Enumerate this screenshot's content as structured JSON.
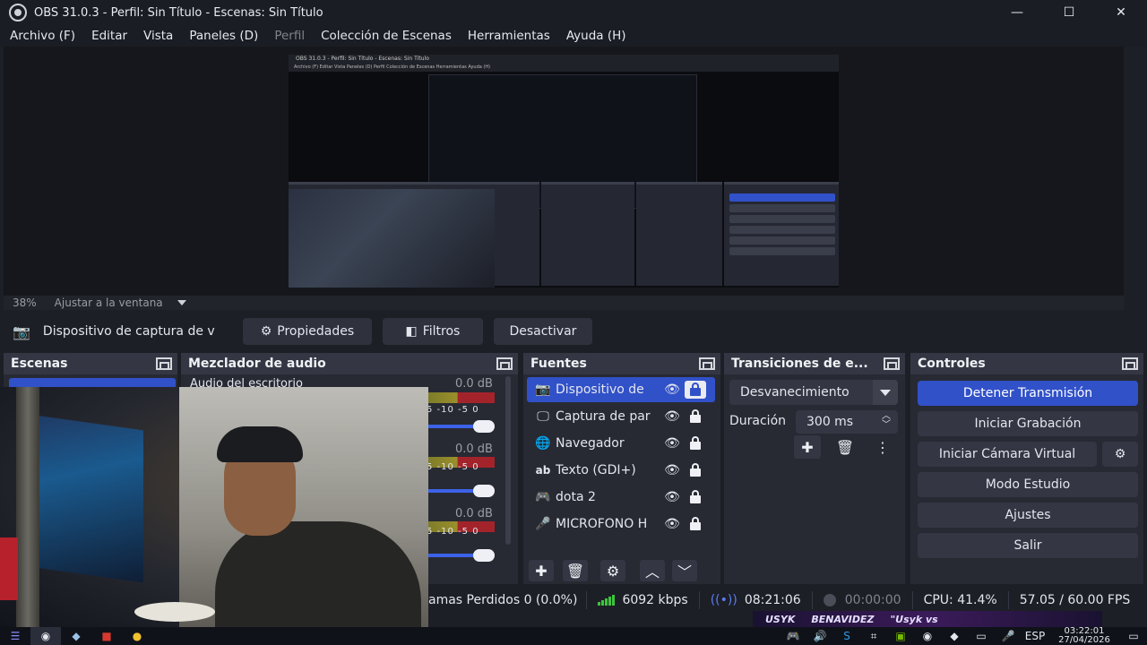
{
  "window": {
    "title": "OBS 31.0.3 - Perfil: Sin Título - Escenas: Sin Título",
    "minimize": "—",
    "maximize": "☐",
    "close": "✕"
  },
  "menu": [
    {
      "label": "Archivo (F)",
      "enabled": true
    },
    {
      "label": "Editar",
      "enabled": true
    },
    {
      "label": "Vista",
      "enabled": true
    },
    {
      "label": "Paneles (D)",
      "enabled": true
    },
    {
      "label": "Perfil",
      "enabled": false
    },
    {
      "label": "Colección de Escenas",
      "enabled": true
    },
    {
      "label": "Herramientas",
      "enabled": true
    },
    {
      "label": "Ayuda (H)",
      "enabled": true
    }
  ],
  "zoom": {
    "value": "38%",
    "mode": "Ajustar a la ventana"
  },
  "source_toolbar": {
    "source_name": "Dispositivo de captura de v",
    "properties": "Propiedades",
    "filters": "Filtros",
    "deactivate": "Desactivar"
  },
  "scenes": {
    "title": "Escenas"
  },
  "mixer": {
    "title": "Mezclador de audio",
    "channels": [
      {
        "label": "Audio del escritorio",
        "db": "0.0 dB",
        "scale": "5 -10 -5 0"
      },
      {
        "label": "",
        "db": "0.0 dB",
        "scale": "5 -10 -5 0"
      },
      {
        "label": "",
        "db": "0.0 dB",
        "scale": "5 -10 -5 0"
      }
    ]
  },
  "sources": {
    "title": "Fuentes",
    "items": [
      {
        "name": "Dispositivo de",
        "icon": "camera-icon",
        "glyph": "📷",
        "selected": true
      },
      {
        "name": "Captura de par",
        "icon": "monitor-icon",
        "glyph": "🖵",
        "selected": false
      },
      {
        "name": "Navegador",
        "icon": "globe-icon",
        "glyph": "🌐",
        "selected": false
      },
      {
        "name": "Texto (GDI+)",
        "icon": "text-icon",
        "glyph": "ab",
        "selected": false
      },
      {
        "name": "dota 2",
        "icon": "gamepad-icon",
        "glyph": "🎮",
        "selected": false
      },
      {
        "name": "MICROFONO H",
        "icon": "microphone-icon",
        "glyph": "🎤",
        "selected": false
      }
    ]
  },
  "transitions": {
    "title": "Transiciones de e...",
    "selected": "Desvanecimiento",
    "duration_label": "Duración",
    "duration": "300 ms"
  },
  "controls": {
    "title": "Controles",
    "stop_stream": "Detener Transmisión",
    "start_recording": "Iniciar Grabación",
    "virtual_camera": "Iniciar Cámara Virtual",
    "studio_mode": "Modo Estudio",
    "settings": "Ajustes",
    "exit": "Salir"
  },
  "status": {
    "dropped_frames": "amas Perdidos 0 (0.0%)",
    "bitrate": "6092 kbps",
    "stream_time": "08:21:06",
    "record_time": "00:00:00",
    "cpu": "CPU: 41.4%",
    "fps": "57.05 / 60.00 FPS"
  },
  "taskbar": {
    "language": "ESP",
    "time": "03:22:01",
    "date": "27/04/2026",
    "banner": [
      "USYK",
      "BENAVIDEZ",
      "\"Usyk vs"
    ]
  },
  "preview_mini": {
    "title": "OBS 31.0.3 - Perfil: Sin Título - Escenas: Sin Título",
    "menu": "Archivo (F)   Editar   Vista   Paneles (D)   Perfil   Colección de Escenas   Herramientas   Ayuda (H)"
  },
  "colors": {
    "accent": "#3151c9",
    "dock_bg": "#272a33",
    "dock_header": "#343743"
  }
}
